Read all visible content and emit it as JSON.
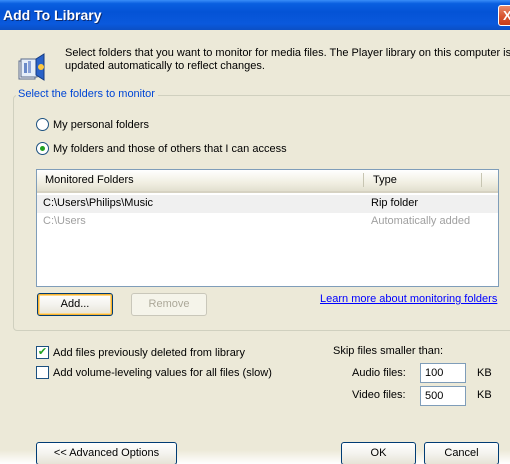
{
  "window": {
    "title": "Add To Library",
    "close_glyph": "X"
  },
  "intro": {
    "line1": "Select folders that you want to monitor for media files. The Player library on this computer is",
    "line2": "updated automatically to reflect changes.",
    "icon": "library-icon"
  },
  "monitor_group": {
    "legend": "Select the folders to monitor",
    "options": [
      {
        "label": "My personal folders",
        "selected": false
      },
      {
        "label": "My folders and those of others that I can access",
        "selected": true
      }
    ]
  },
  "folders_list": {
    "columns": [
      "Monitored Folders",
      "Type"
    ],
    "rows": [
      {
        "folder": "C:\\Users\\Philips\\Music",
        "type": "Rip folder",
        "selected": true
      },
      {
        "folder": "C:\\Users",
        "type": "Automatically added",
        "selected": false
      }
    ]
  },
  "buttons": {
    "add": "Add...",
    "remove": "Remove",
    "advanced": "<< Advanced Options",
    "ok": "OK",
    "cancel": "Cancel"
  },
  "link": "Learn more about monitoring folders",
  "options": {
    "add_deleted": {
      "label": "Add files previously deleted from library",
      "checked": true
    },
    "volume_leveling": {
      "label": "Add volume-leveling values for all files (slow)",
      "checked": false
    }
  },
  "skip": {
    "heading": "Skip files smaller than:",
    "audio_label": "Audio files:",
    "audio_value": "100",
    "video_label": "Video files:",
    "video_value": "500",
    "unit": "KB"
  },
  "colors": {
    "titlebar": "#0453d6",
    "dialog_bg": "#ece9d8",
    "legend_text": "#0046d5",
    "link": "#0000ff",
    "selected_row": "#f0f0f0"
  }
}
